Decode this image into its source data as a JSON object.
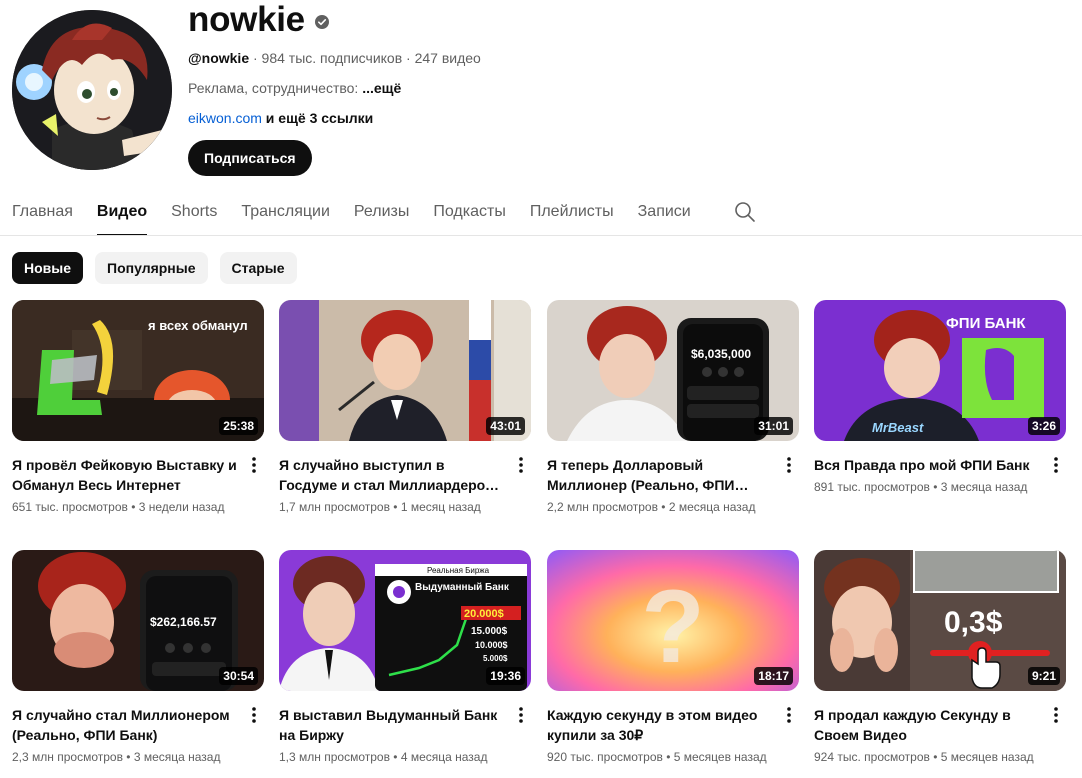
{
  "channel": {
    "name": "nowkie",
    "handle": "@nowkie",
    "stats": " · 984 тыс. подписчиков · 247 видео",
    "description": "Реклама, сотрудничество: ",
    "description_more": "...ещё",
    "link": "eikwon.com",
    "more_links": " и ещё 3 ссылки",
    "subscribe_label": "Подписаться",
    "verified_icon": "verified-badge-icon"
  },
  "tabs": [
    {
      "label": "Главная"
    },
    {
      "label": "Видео"
    },
    {
      "label": "Shorts"
    },
    {
      "label": "Трансляции"
    },
    {
      "label": "Релизы"
    },
    {
      "label": "Подкасты"
    },
    {
      "label": "Плейлисты"
    },
    {
      "label": "Записи"
    }
  ],
  "active_tab": "Видео",
  "chips": [
    {
      "label": "Новые"
    },
    {
      "label": "Популярные"
    },
    {
      "label": "Старые"
    }
  ],
  "videos": [
    {
      "title": "Я провёл Фейковую Выставку и Обманул Весь Интернет",
      "meta": "651 тыс. просмотров • 3 недели назад",
      "duration": "25:38",
      "thumb_text": "я всех обманул"
    },
    {
      "title": "Я случайно выступил в Госдуме и стал Миллиардером (Реально,...",
      "meta": "1,7 млн просмотров • 1 месяц назад",
      "duration": "43:01"
    },
    {
      "title": "Я теперь Долларовый Миллионер (Реально, ФПИ Банк)",
      "meta": "2,2 млн просмотров • 2 месяца назад",
      "duration": "31:01",
      "thumb_text": "$6,035,000"
    },
    {
      "title": "Вся Правда про мой ФПИ Банк",
      "meta": "891 тыс. просмотров • 3 месяца назад",
      "duration": "3:26",
      "thumb_text": "ФПИ БАНК",
      "thumb_text_2": "MrBeast"
    },
    {
      "title": "Я случайно стал Миллионером (Реально, ФПИ Банк)",
      "meta": "2,3 млн просмотров • 3 месяца назад",
      "duration": "30:54",
      "thumb_text": "$262,166.57"
    },
    {
      "title": "Я выставил Выдуманный Банк на Биржу",
      "meta": "1,3 млн просмотров • 4 месяца назад",
      "duration": "19:36",
      "thumb_text": "Выдуманный Банк",
      "thumb_header": "Реальная Биржа",
      "thumb_prices": [
        "20.000$",
        "15.000$",
        "10.000$",
        "5.000$"
      ]
    },
    {
      "title": "Каждую секунду в этом видео купили за 30₽",
      "meta": "920 тыс. просмотров • 5 месяцев назад",
      "duration": "18:17",
      "thumb_text": "?"
    },
    {
      "title": "Я продал каждую Секунду в Своем Видео",
      "meta": "924 тыс. просмотров • 5 месяцев назад",
      "duration": "9:21",
      "thumb_text": "0,3$"
    }
  ],
  "colors": {
    "accent": "#0f0f0f",
    "link": "#065fd4",
    "secondary_text": "#606060",
    "chip_bg": "#f2f2f2"
  }
}
